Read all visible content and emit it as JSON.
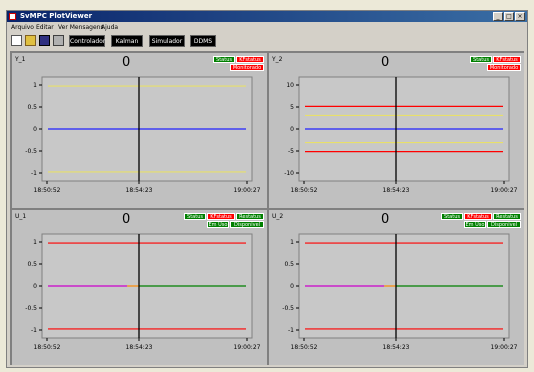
{
  "app": {
    "title": "SvMPC PlotViewer"
  },
  "window_buttons": {
    "minimize": "_",
    "maximize": "□",
    "close": "×"
  },
  "menu": [
    "Arquivo",
    "Editar",
    "Ver Mensagens",
    "Ajuda"
  ],
  "toolbar": {
    "buttons": [
      "Controlador",
      "Kalman",
      "Simulador",
      "DDMS"
    ]
  },
  "panels": [
    {
      "id": "Y_1",
      "value": "0",
      "status": [
        [
          "Status",
          "KFstatus"
        ],
        [
          "Monitorado"
        ]
      ],
      "status_colors": [
        [
          "#008000",
          "#ff0000"
        ],
        [
          "#ff0000"
        ]
      ],
      "y_ticks": [
        "1",
        "0.5",
        "0",
        "-0.5",
        "-1"
      ],
      "y_range": [
        -1.15,
        1.15
      ],
      "x_ticks": [
        "18:50:52",
        "18:54:23",
        "19:00:27"
      ],
      "cursor_fraction": 0.46,
      "lines": [
        {
          "color": "#e8e06a",
          "value": 0.95
        },
        {
          "color": "#e8e06a",
          "value": -0.95
        },
        {
          "color": "#2222ff",
          "value": 0.0
        }
      ]
    },
    {
      "id": "Y_2",
      "value": "0",
      "status": [
        [
          "Status",
          "KFstatus"
        ],
        [
          "Monitorado"
        ]
      ],
      "status_colors": [
        [
          "#008000",
          "#ff0000"
        ],
        [
          "#ff0000"
        ]
      ],
      "y_ticks": [
        "10",
        "5",
        "0",
        "-5",
        "-10"
      ],
      "y_range": [
        -11.5,
        11.5
      ],
      "x_ticks": [
        "18:50:52",
        "18:54:23",
        "19:00:27"
      ],
      "cursor_fraction": 0.46,
      "lines": [
        {
          "color": "#ff0000",
          "value": 5
        },
        {
          "color": "#e8e06a",
          "value": 3
        },
        {
          "color": "#2222ff",
          "value": 0
        },
        {
          "color": "#e8e06a",
          "value": -3
        },
        {
          "color": "#ff0000",
          "value": -5
        }
      ]
    },
    {
      "id": "U_1",
      "value": "0",
      "status": [
        [
          "Status",
          "KFstatus",
          "Restatus"
        ],
        [
          "Em Uso",
          "Disponivel"
        ]
      ],
      "status_colors": [
        [
          "#008000",
          "#ff0000",
          "#008000"
        ],
        [
          "#008000",
          "#008000"
        ]
      ],
      "y_ticks": [
        "1",
        "0.5",
        "0",
        "-0.5",
        "-1"
      ],
      "y_range": [
        -1.15,
        1.15
      ],
      "x_ticks": [
        "18:50:52",
        "18:54:23",
        "19:00:27"
      ],
      "cursor_fraction": 0.46,
      "lines": [
        {
          "color": "#ff0000",
          "value": 0.95
        },
        {
          "color": "#ff0000",
          "value": -0.95
        },
        {
          "color": "#cc00cc",
          "value": 0.0,
          "end": 0.4
        },
        {
          "color": "#ff8800",
          "value": 0.0,
          "start": 0.4,
          "end": 0.46
        },
        {
          "color": "#008000",
          "value": 0.0,
          "start": 0.46
        }
      ]
    },
    {
      "id": "U_2",
      "value": "0",
      "status": [
        [
          "Status",
          "KFstatus",
          "Restatus"
        ],
        [
          "Em Uso",
          "Disponivel"
        ]
      ],
      "status_colors": [
        [
          "#008000",
          "#ff0000",
          "#008000"
        ],
        [
          "#008000",
          "#008000"
        ]
      ],
      "y_ticks": [
        "1",
        "0.5",
        "0",
        "-0.5",
        "-1"
      ],
      "y_range": [
        -1.15,
        1.15
      ],
      "x_ticks": [
        "18:50:52",
        "18:54:23",
        "19:00:27"
      ],
      "cursor_fraction": 0.46,
      "lines": [
        {
          "color": "#ff0000",
          "value": 0.95
        },
        {
          "color": "#ff0000",
          "value": -0.95
        },
        {
          "color": "#cc00cc",
          "value": 0.0,
          "end": 0.4
        },
        {
          "color": "#ff8800",
          "value": 0.0,
          "start": 0.4,
          "end": 0.46
        },
        {
          "color": "#008000",
          "value": 0.0,
          "start": 0.46
        }
      ]
    }
  ]
}
